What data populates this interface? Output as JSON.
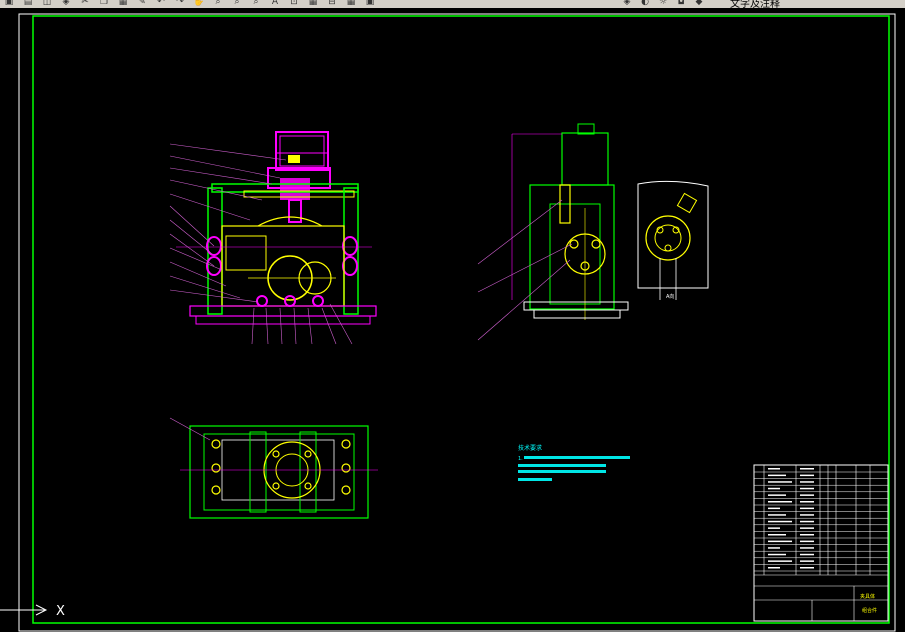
{
  "toolbar": {
    "buttons": [
      {
        "name": "save-icon",
        "glyph": "▣"
      },
      {
        "name": "print-icon",
        "glyph": "▤"
      },
      {
        "name": "preview-icon",
        "glyph": "◫"
      },
      {
        "name": "publish-icon",
        "glyph": "◈"
      },
      {
        "name": "cut-icon",
        "glyph": "✂"
      },
      {
        "name": "copy-icon",
        "glyph": "❐"
      },
      {
        "name": "paste-icon",
        "glyph": "▦"
      },
      {
        "name": "match-properties-icon",
        "glyph": "✎"
      },
      {
        "name": "undo-icon",
        "glyph": "↶"
      },
      {
        "name": "redo-icon",
        "glyph": "↷"
      },
      {
        "name": "pan-icon",
        "glyph": "✋"
      },
      {
        "name": "zoom-realtime-icon",
        "glyph": "⌕"
      },
      {
        "name": "zoom-window-icon",
        "glyph": "⌕"
      },
      {
        "name": "zoom-previous-icon",
        "glyph": "⌕"
      },
      {
        "name": "text-style-icon",
        "glyph": "A"
      },
      {
        "name": "dimension-style-icon",
        "glyph": "⊡"
      },
      {
        "name": "table-style-icon",
        "glyph": "▦"
      },
      {
        "name": "multileader-style-icon",
        "glyph": "⊟"
      },
      {
        "name": "grid-icon",
        "glyph": "▦"
      },
      {
        "name": "properties-icon",
        "glyph": "▣"
      },
      {
        "name": "layer-manager-icon",
        "glyph": "◈"
      },
      {
        "name": "layer-bulb-icon",
        "glyph": "◐"
      },
      {
        "name": "layer-sun-icon",
        "glyph": "☼"
      },
      {
        "name": "layer-lock-icon",
        "glyph": "◘"
      },
      {
        "name": "layer-color-icon",
        "glyph": "◆"
      }
    ],
    "layer_label": "文字及注释"
  },
  "drawing": {
    "ucs_x_label": "X",
    "tech_req_title": "技术要求",
    "tech_req_line1": "1. ",
    "section_label": "A向",
    "title_block_name": "夹具体",
    "title_block_material": "组合件"
  },
  "colors": {
    "frame": "#00ff00",
    "magenta": "#ff00ff",
    "yellow": "#ffff00",
    "cyan": "#00ffff",
    "white": "#ffffff",
    "leader": "#d060d0"
  }
}
